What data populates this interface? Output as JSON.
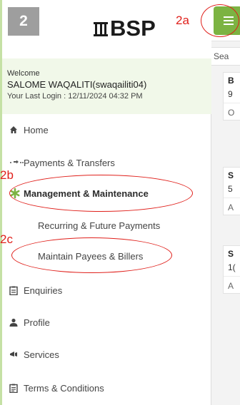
{
  "step_badge": "2",
  "logo": {
    "text": "BSP"
  },
  "background": {
    "search_text": "Sea",
    "cards": [
      {
        "title": "B",
        "sub": "9",
        "foot": "O"
      },
      {
        "title": "S",
        "sub": "5",
        "foot": "A"
      },
      {
        "title": "S",
        "sub": "1(",
        "foot": "A"
      }
    ]
  },
  "user": {
    "welcome": "Welcome",
    "name": "SALOME WAQALITI(swaqailiti04)",
    "last_login": "Your Last Login : 12/11/2024 04:32 PM"
  },
  "nav": {
    "home": "Home",
    "payments": "Payments & Transfers",
    "management": "Management & Maintenance",
    "recurring": "Recurring & Future Payments",
    "payees": "Maintain Payees & Billers",
    "enquiries": "Enquiries",
    "profile": "Profile",
    "services": "Services",
    "terms": "Terms & Conditions"
  },
  "annotations": {
    "a": "2a",
    "b": "2b",
    "c": "2c"
  },
  "colors": {
    "accent_green": "#7cb342",
    "annotation_red": "#e0201b",
    "badge_gray": "#9e9e9e",
    "user_bg": "#f1f8e9"
  },
  "icons": {
    "menu": "hamburger-menu-icon",
    "home": "home-icon",
    "payments": "transfer-arrows-icon",
    "management": "asterisk-icon",
    "enquiries": "clipboard-list-icon",
    "profile": "person-icon",
    "services": "megaphone-icon",
    "terms": "document-icon"
  }
}
